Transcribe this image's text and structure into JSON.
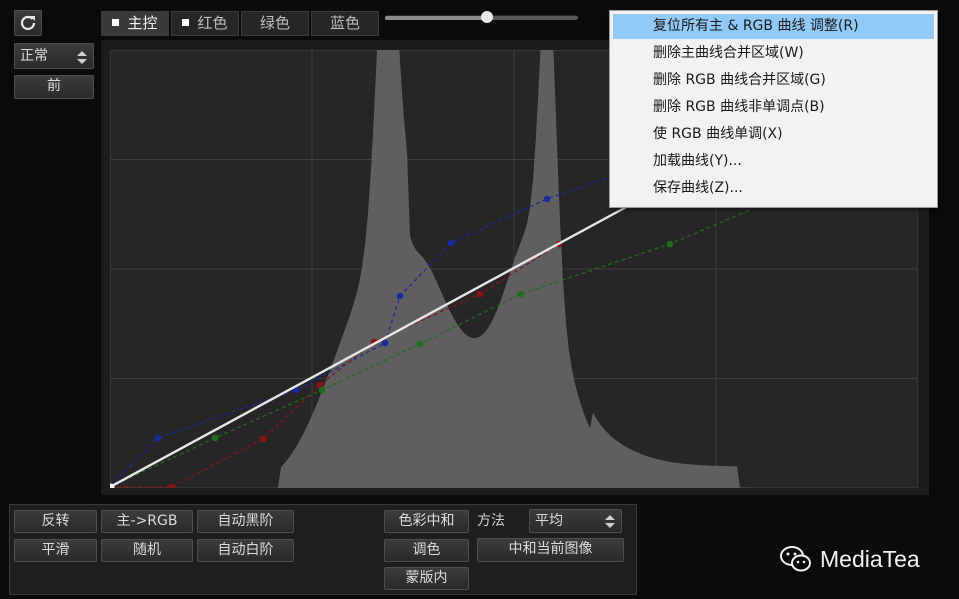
{
  "left_panel": {
    "blend_mode": "正常",
    "before_button": "前"
  },
  "tabs": [
    {
      "label": "主控",
      "active": true,
      "checkbox": true
    },
    {
      "label": "红色",
      "active": false,
      "checkbox": true
    },
    {
      "label": "绿色",
      "active": false,
      "checkbox": false
    },
    {
      "label": "蓝色",
      "active": false,
      "checkbox": false
    }
  ],
  "slider_value": 0.53,
  "context_menu": {
    "items": [
      "复位所有主 & RGB 曲线 调整(R)",
      "删除主曲线合并区域(W)",
      "删除 RGB 曲线合并区域(G)",
      "删除 RGB 曲线非单调点(B)",
      "使 RGB 曲线单调(X)",
      "加载曲线(Y)...",
      "保存曲线(Z)..."
    ],
    "highlighted_index": 0
  },
  "bottom_buttons": {
    "invert": "反转",
    "master_to_rgb": "主->RGB",
    "auto_black": "自动黑阶",
    "smooth": "平滑",
    "random": "随机",
    "auto_white": "自动白阶",
    "color_neutralize": "色彩中和",
    "color_adjust": "调色",
    "mask_inside": "蒙版内",
    "method_label": "方法",
    "method_value": "平均",
    "neutralize_current": "中和当前图像"
  },
  "watermark": "MediaTea",
  "colors": {
    "master_curve": "#e6e6e6",
    "red_curve": "#8a1414",
    "green_curve": "#1f6e1f",
    "blue_curve": "#1a2a9a",
    "histogram": "#6a6a6a",
    "menu_highlight": "#91c9f7"
  }
}
